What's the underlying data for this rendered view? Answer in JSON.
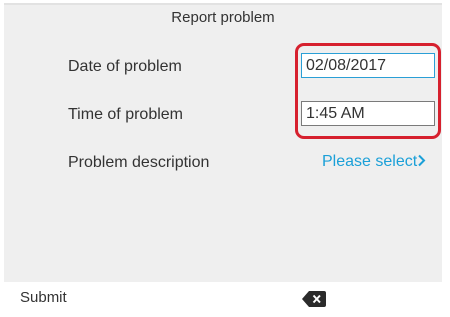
{
  "header": {
    "title": "Report problem"
  },
  "form": {
    "date": {
      "label": "Date of problem",
      "value": "02/08/2017"
    },
    "time": {
      "label": "Time of problem",
      "value": "1:45 AM"
    },
    "description": {
      "label": "Problem description",
      "select_text": "Please select",
      "icon": "chevron-right-icon"
    }
  },
  "softkeys": {
    "submit_label": "Submit",
    "delete_icon": "backspace-icon"
  },
  "colors": {
    "accent": "#1ba0d8",
    "highlight": "#d6202e",
    "focus_border": "#2a9fd6"
  }
}
